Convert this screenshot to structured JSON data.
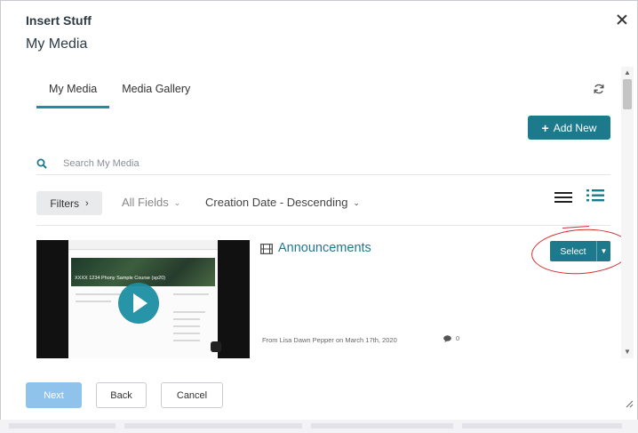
{
  "dialog": {
    "title": "Insert Stuff",
    "subtitle": "My Media"
  },
  "tabs": [
    {
      "label": "My Media",
      "active": true
    },
    {
      "label": "Media Gallery",
      "active": false
    }
  ],
  "toolbar": {
    "add_new_label": "Add New",
    "search_placeholder": "Search My Media",
    "filters_label": "Filters",
    "field_dropdown": "All Fields",
    "sort_dropdown": "Creation Date - Descending"
  },
  "entry": {
    "title": "Announcements",
    "meta": "From Lisa Dawn Pepper on March 17th, 2020",
    "comment_count": "0",
    "select_label": "Select",
    "thumbnail_course_title": "XXXX 1234 Phony Sample Course (sp20)"
  },
  "footer": {
    "next_label": "Next",
    "back_label": "Back",
    "cancel_label": "Cancel"
  },
  "colors": {
    "accent": "#1d7a8c",
    "next_disabled": "#8fc3ec",
    "annotation": "#d62c2c"
  },
  "icons": [
    "close-icon",
    "refresh-icon",
    "plus-icon",
    "search-icon",
    "chevron-right-icon",
    "chevron-down-icon",
    "list-view-icon",
    "detail-view-icon",
    "play-icon",
    "film-icon",
    "comment-icon",
    "resize-icon"
  ]
}
